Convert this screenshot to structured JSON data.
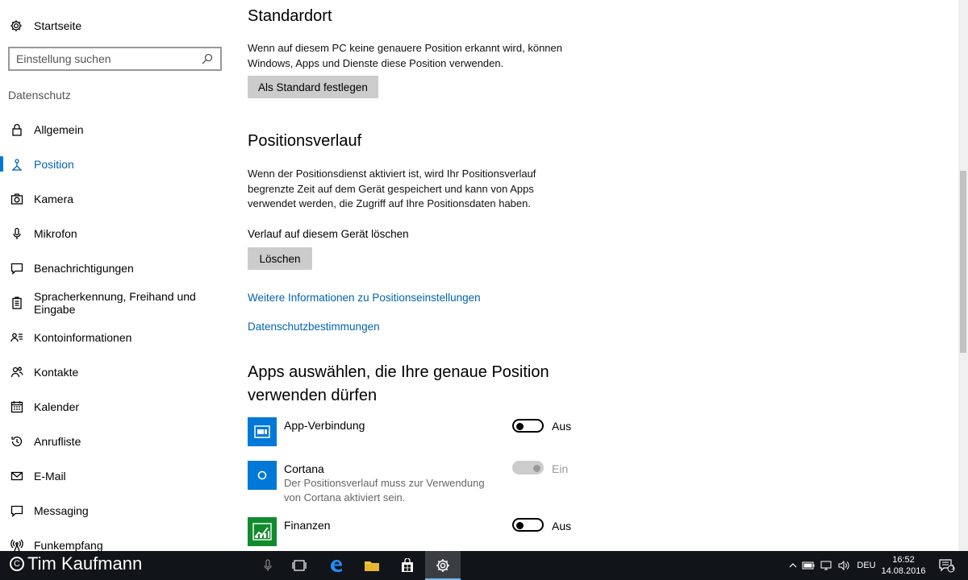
{
  "sidebar": {
    "home_label": "Startseite",
    "search_placeholder": "Einstellung suchen",
    "section_title": "Datenschutz",
    "items": [
      {
        "label": "Allgemein",
        "icon": "lock-icon"
      },
      {
        "label": "Position",
        "icon": "location-icon",
        "active": true
      },
      {
        "label": "Kamera",
        "icon": "camera-icon"
      },
      {
        "label": "Mikrofon",
        "icon": "microphone-icon"
      },
      {
        "label": "Benachrichtigungen",
        "icon": "notification-icon"
      },
      {
        "label": "Spracherkennung, Freihand und Eingabe",
        "icon": "clipboard-icon"
      },
      {
        "label": "Kontoinformationen",
        "icon": "account-info-icon"
      },
      {
        "label": "Kontakte",
        "icon": "contacts-icon"
      },
      {
        "label": "Kalender",
        "icon": "calendar-icon"
      },
      {
        "label": "Anrufliste",
        "icon": "call-history-icon"
      },
      {
        "label": "E-Mail",
        "icon": "mail-icon"
      },
      {
        "label": "Messaging",
        "icon": "messaging-icon"
      },
      {
        "label": "Funkempfang",
        "icon": "radio-icon"
      }
    ]
  },
  "main": {
    "default_location": {
      "heading": "Standardort",
      "text": "Wenn auf diesem PC keine genauere Position erkannt wird, können Windows, Apps und Dienste diese Position verwenden.",
      "button": "Als Standard festlegen"
    },
    "history": {
      "heading": "Positionsverlauf",
      "text": "Wenn der Positionsdienst aktiviert ist, wird Ihr Positionsverlauf begrenzte Zeit auf dem Gerät gespeichert und kann von Apps verwendet werden, die Zugriff auf Ihre Positionsdaten haben.",
      "clear_label": "Verlauf auf diesem Gerät löschen",
      "clear_button": "Löschen"
    },
    "links": {
      "more_info": "Weitere Informationen zu Positionseinstellungen",
      "privacy": "Datenschutzbestimmungen"
    },
    "apps": {
      "heading": "Apps auswählen, die Ihre genaue Position verwenden dürfen",
      "list": [
        {
          "name": "App-Verbindung",
          "desc": "",
          "state": "Aus",
          "tile_color": "#0078d7"
        },
        {
          "name": "Cortana",
          "desc": "Der Positionsverlauf muss zur Verwendung von Cortana aktiviert sein.",
          "state": "Ein",
          "tile_color": "#0078d7"
        },
        {
          "name": "Finanzen",
          "desc": "",
          "state": "Aus",
          "tile_color": "#128a2e"
        }
      ]
    }
  },
  "taskbar": {
    "watermark": "Tim Kaufmann",
    "language": "DEU",
    "time": "16:52",
    "date": "14.08.2016",
    "notification_count": "1"
  }
}
